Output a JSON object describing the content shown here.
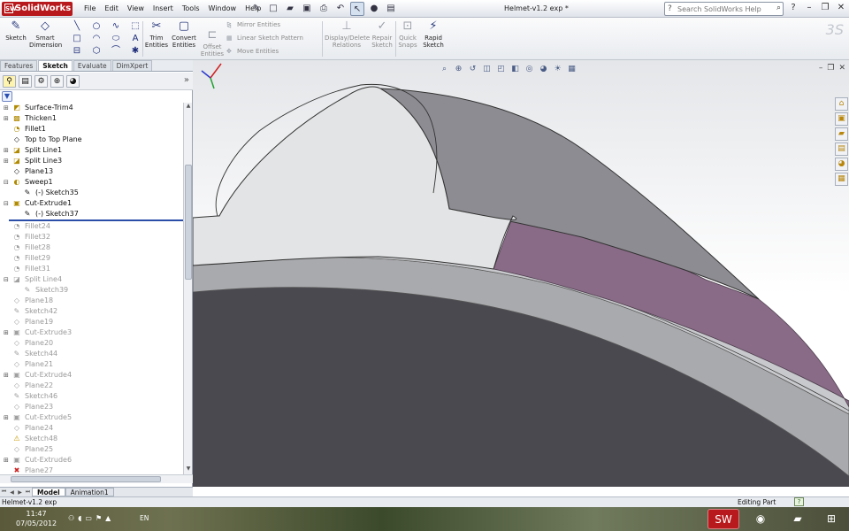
{
  "app": {
    "logo": "SolidWorks",
    "document_title": "Helmet-v1.2 exp *",
    "menus": [
      "File",
      "Edit",
      "View",
      "Insert",
      "Tools",
      "Window",
      "Help"
    ]
  },
  "search": {
    "placeholder": "Search SolidWorks Help"
  },
  "ribbon": {
    "sketch": "Sketch",
    "smart_dimension_1": "Smart",
    "smart_dimension_2": "Dimension",
    "trim_1": "Trim",
    "trim_2": "Entities",
    "convert_1": "Convert",
    "convert_2": "Entities",
    "offset_1": "Offset",
    "offset_2": "Entities",
    "mirror": "Mirror Entities",
    "linear_pattern": "Linear Sketch Pattern",
    "move": "Move Entities",
    "display_delete_1": "Display/Delete",
    "display_delete_2": "Relations",
    "repair_1": "Repair",
    "repair_2": "Sketch",
    "quick_snaps_1": "Quick",
    "quick_snaps_2": "Snaps",
    "rapid_1": "Rapid",
    "rapid_2": "Sketch"
  },
  "command_tabs": [
    "Features",
    "Sketch",
    "Evaluate",
    "DimXpert"
  ],
  "active_command_tab": "Sketch",
  "tree": [
    {
      "label": "Surface-Trim4",
      "indent": 0,
      "icon": "surface-trim-icon",
      "state": "active",
      "expand": "+"
    },
    {
      "label": "Thicken1",
      "indent": 0,
      "icon": "thicken-icon",
      "state": "active",
      "expand": "+"
    },
    {
      "label": "Fillet1",
      "indent": 0,
      "icon": "fillet-icon",
      "state": "active",
      "expand": ""
    },
    {
      "label": "Top to Top Plane",
      "indent": 0,
      "icon": "plane-icon",
      "state": "active",
      "expand": ""
    },
    {
      "label": "Split Line1",
      "indent": 0,
      "icon": "split-line-icon",
      "state": "active",
      "expand": "+"
    },
    {
      "label": "Split Line3",
      "indent": 0,
      "icon": "split-line-icon",
      "state": "active",
      "expand": "+"
    },
    {
      "label": "Plane13",
      "indent": 0,
      "icon": "plane-icon",
      "state": "active",
      "expand": ""
    },
    {
      "label": "Sweep1",
      "indent": 0,
      "icon": "sweep-icon",
      "state": "active",
      "expand": "-"
    },
    {
      "label": "(-) Sketch35",
      "indent": 1,
      "icon": "sketch-icon",
      "state": "active",
      "expand": ""
    },
    {
      "label": "Cut-Extrude1",
      "indent": 0,
      "icon": "cut-extrude-icon",
      "state": "active",
      "expand": "-"
    },
    {
      "label": "(-) Sketch37",
      "indent": 1,
      "icon": "sketch-icon",
      "state": "active",
      "expand": ""
    },
    {
      "label": "Fillet24",
      "indent": 0,
      "icon": "fillet-icon",
      "state": "suppressed",
      "expand": ""
    },
    {
      "label": "Fillet32",
      "indent": 0,
      "icon": "fillet-icon",
      "state": "suppressed",
      "expand": ""
    },
    {
      "label": "Fillet28",
      "indent": 0,
      "icon": "fillet-icon",
      "state": "suppressed",
      "expand": ""
    },
    {
      "label": "Fillet29",
      "indent": 0,
      "icon": "fillet-icon",
      "state": "suppressed",
      "expand": ""
    },
    {
      "label": "Fillet31",
      "indent": 0,
      "icon": "fillet-icon",
      "state": "suppressed",
      "expand": ""
    },
    {
      "label": "Split Line4",
      "indent": 0,
      "icon": "split-line-icon",
      "state": "suppressed",
      "expand": "-"
    },
    {
      "label": "Sketch39",
      "indent": 1,
      "icon": "sketch-icon",
      "state": "suppressed",
      "expand": ""
    },
    {
      "label": "Plane18",
      "indent": 0,
      "icon": "plane-icon",
      "state": "suppressed",
      "expand": ""
    },
    {
      "label": "Sketch42",
      "indent": 0,
      "icon": "sketch-icon",
      "state": "suppressed",
      "expand": ""
    },
    {
      "label": "Plane19",
      "indent": 0,
      "icon": "plane-icon",
      "state": "suppressed",
      "expand": ""
    },
    {
      "label": "Cut-Extrude3",
      "indent": 0,
      "icon": "cut-extrude-icon",
      "state": "suppressed",
      "expand": "+"
    },
    {
      "label": "Plane20",
      "indent": 0,
      "icon": "plane-icon",
      "state": "suppressed",
      "expand": ""
    },
    {
      "label": "Sketch44",
      "indent": 0,
      "icon": "sketch-icon",
      "state": "suppressed",
      "expand": ""
    },
    {
      "label": "Plane21",
      "indent": 0,
      "icon": "plane-icon",
      "state": "suppressed",
      "expand": ""
    },
    {
      "label": "Cut-Extrude4",
      "indent": 0,
      "icon": "cut-extrude-icon",
      "state": "suppressed",
      "expand": "+"
    },
    {
      "label": "Plane22",
      "indent": 0,
      "icon": "plane-icon",
      "state": "suppressed",
      "expand": ""
    },
    {
      "label": "Sketch46",
      "indent": 0,
      "icon": "sketch-icon",
      "state": "suppressed",
      "expand": ""
    },
    {
      "label": "Plane23",
      "indent": 0,
      "icon": "plane-icon",
      "state": "suppressed",
      "expand": ""
    },
    {
      "label": "Cut-Extrude5",
      "indent": 0,
      "icon": "cut-extrude-icon",
      "state": "suppressed",
      "expand": "+"
    },
    {
      "label": "Plane24",
      "indent": 0,
      "icon": "plane-icon",
      "state": "suppressed",
      "expand": ""
    },
    {
      "label": "Sketch48",
      "indent": 0,
      "icon": "warning-icon",
      "state": "suppressed",
      "expand": ""
    },
    {
      "label": "Plane25",
      "indent": 0,
      "icon": "plane-icon",
      "state": "suppressed",
      "expand": ""
    },
    {
      "label": "Cut-Extrude6",
      "indent": 0,
      "icon": "cut-extrude-icon",
      "state": "suppressed",
      "expand": "+"
    },
    {
      "label": "Plane27",
      "indent": 0,
      "icon": "error-icon",
      "state": "suppressed",
      "expand": ""
    }
  ],
  "model_tabs": [
    "Model",
    "Animation1"
  ],
  "active_model_tab": "Model",
  "status": {
    "file": "Helmet-v1.2 exp",
    "mode": "Editing Part",
    "help": "?"
  },
  "taskbar": {
    "time": "11:47",
    "date": "07/05/2012",
    "language": "EN"
  },
  "colors": {
    "brand": "#b7191c",
    "selection": "#2b4fa8",
    "purple_face": "#8a6b87",
    "dark_body": "#4a4950"
  }
}
